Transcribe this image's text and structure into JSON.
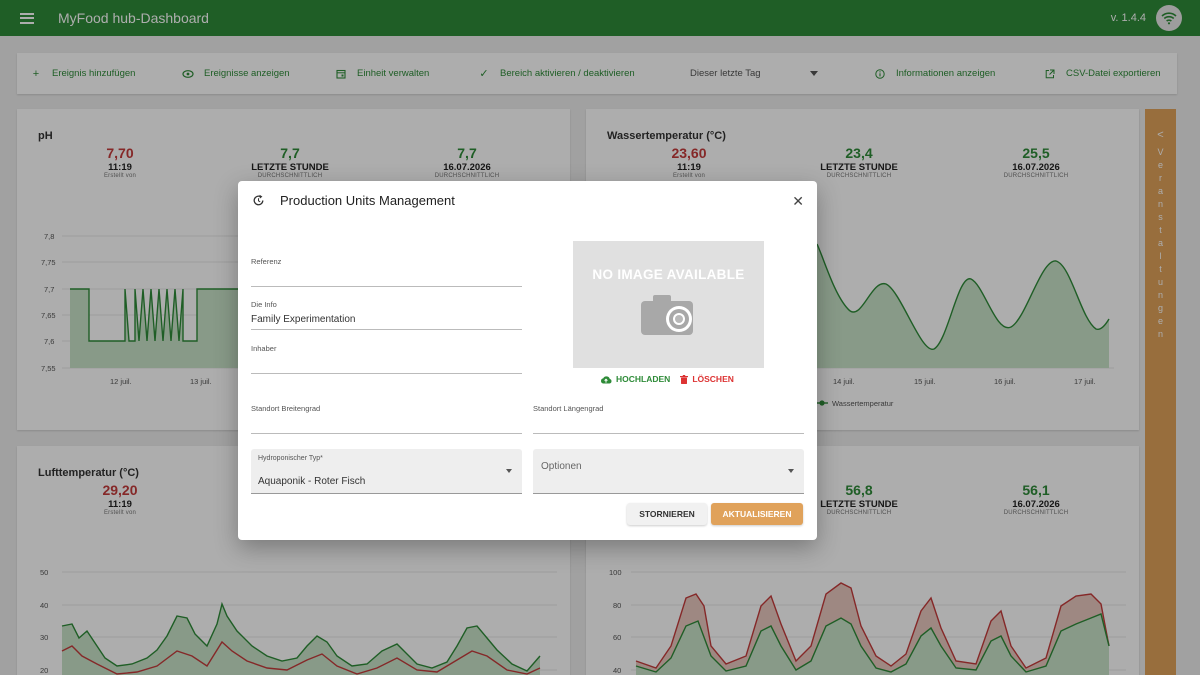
{
  "appbar": {
    "title": "MyFood hub-Dashboard",
    "version": "v. 1.4.4",
    "menu_icon": "menu-icon",
    "wifi_icon": "wifi-icon"
  },
  "toolbar": {
    "items": [
      {
        "label": "Ereignis hinzufügen",
        "icon": "plus-icon"
      },
      {
        "label": "Ereignisse anzeigen",
        "icon": "eye-icon"
      },
      {
        "label": "Einheit verwalten",
        "icon": "calendar-icon"
      },
      {
        "label": "Bereich aktivieren / deaktivieren",
        "icon": "check-icon"
      },
      {
        "label": "Informationen anzeigen",
        "icon": "info-icon"
      },
      {
        "label": "CSV-Datei exportieren",
        "icon": "export-icon"
      }
    ],
    "period_select": "Dieser letzte Tag"
  },
  "cards": {
    "ph": {
      "title": "pH",
      "stats": [
        {
          "value": "7,70",
          "main": "11:19",
          "sub": "Erstellt von"
        },
        {
          "value": "7,7",
          "main": "LETZTE STUNDE",
          "sub": "DURCHSCHNITTLICH"
        },
        {
          "value": "7,7",
          "main": "16.07.2026",
          "sub": "DURCHSCHNITTLICH"
        }
      ],
      "y_ticks": [
        "7,8",
        "7,75",
        "7,7",
        "7,65",
        "7,6",
        "7,55"
      ],
      "x_ticks": [
        "12 juil.",
        "13 juil."
      ]
    },
    "water": {
      "title": "Wassertemperatur (°C)",
      "stats": [
        {
          "value": "23,60",
          "main": "11:19",
          "sub": "Erstellt von"
        },
        {
          "value": "23,4",
          "main": "LETZTE STUNDE",
          "sub": "DURCHSCHNITTLICH"
        },
        {
          "value": "25,5",
          "main": "16.07.2026",
          "sub": "DURCHSCHNITTLICH"
        }
      ],
      "x_ticks": [
        "14 juil.",
        "15 juil.",
        "16 juil.",
        "17 juil."
      ],
      "legend": "Wassertemperatur"
    },
    "air": {
      "title": "Lufttemperatur (°C)",
      "stats": [
        {
          "value": "29,20",
          "main": "11:19",
          "sub": "Erstellt von"
        }
      ],
      "y_ticks": [
        "50",
        "40",
        "30",
        "20"
      ]
    },
    "humidity": {
      "stats": [
        {
          "value": "56,8",
          "main": "LETZTE STUNDE",
          "sub": "DURCHSCHNITTLICH"
        },
        {
          "value": "56,1",
          "main": "16.07.2026",
          "sub": "DURCHSCHNITTLICH"
        }
      ],
      "y_ticks": [
        "100",
        "80",
        "60",
        "40"
      ]
    }
  },
  "side_tab": {
    "chevron": "<",
    "letters": [
      "V",
      "e",
      "r",
      "a",
      "n",
      "s",
      "t",
      "a",
      "l",
      "t",
      "u",
      "n",
      "g",
      "e",
      "n"
    ]
  },
  "dialog": {
    "title": "Production Units Management",
    "refresh_icon": "refresh-icon",
    "close_label": "✕",
    "fields": {
      "reference": {
        "label": "Referenz",
        "value": ""
      },
      "info": {
        "label": "Die Info",
        "value": "Family Experimentation"
      },
      "owner": {
        "label": "Inhaber",
        "value": ""
      },
      "latitude": {
        "label": "Standort Breitengrad",
        "value": ""
      },
      "longitude": {
        "label": "Standort Längengrad",
        "value": ""
      },
      "hydro_type": {
        "label": "Hydroponischer Typ*",
        "value": "Aquaponik - Roter Fisch"
      },
      "options": {
        "placeholder": "Optionen"
      }
    },
    "image": {
      "placeholder_text": "NO IMAGE AVAILABLE",
      "upload_label": "HOCHLADEN",
      "delete_label": "LÖSCHEN"
    },
    "buttons": {
      "cancel": "STORNIEREN",
      "update": "AKTUALISIEREN"
    }
  },
  "colors": {
    "primary": "#2e8b38",
    "accent": "#e0a25b",
    "red": "#c43c3c"
  }
}
